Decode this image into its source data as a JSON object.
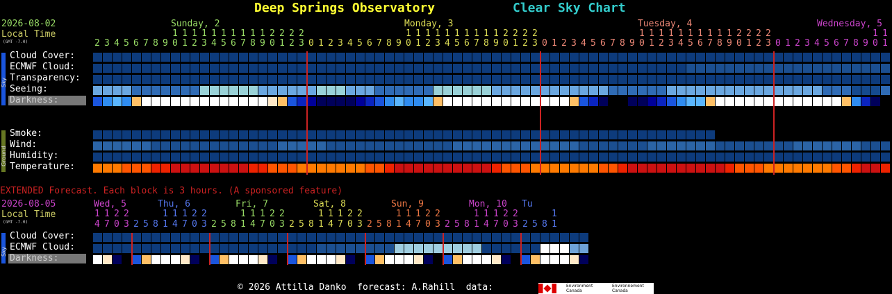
{
  "header": {
    "title": "Deep Springs Observatory",
    "subtitle": "Clear Sky Chart",
    "date": "2026-08-02",
    "local_time_label": "Local Time",
    "gmt_label": "(GMT -7.0)"
  },
  "colors": {
    "title": "#ffff33",
    "subtitle": "#33cccc",
    "date": "#99dd66",
    "local_time": "#cccc66",
    "midnight_line": "#cc2222",
    "extended_note": "#cc2222"
  },
  "days": [
    {
      "label": "Sunday, 2",
      "color": "#99dd66"
    },
    {
      "label": "Monday, 3",
      "color": "#dddd55"
    },
    {
      "label": "Tuesday, 4",
      "color": "#ee8877"
    },
    {
      "label": "Wednesday, 5",
      "color": "#cc44cc"
    }
  ],
  "hours": [
    2,
    3,
    4,
    5,
    6,
    7,
    8,
    9,
    10,
    11,
    12,
    13,
    14,
    15,
    16,
    17,
    18,
    19,
    20,
    21,
    22,
    23,
    0,
    1,
    2,
    3,
    4,
    5,
    6,
    7,
    8,
    9,
    10,
    11,
    12,
    13,
    14,
    15,
    16,
    17,
    18,
    19,
    20,
    21,
    22,
    23,
    0,
    1,
    2,
    3,
    4,
    5,
    6,
    7,
    8,
    9,
    10,
    11,
    12,
    13,
    14,
    15,
    16,
    17,
    18,
    19,
    20,
    21,
    22,
    23,
    0,
    1,
    2,
    3,
    4,
    5,
    6,
    7,
    8,
    9,
    10,
    11
  ],
  "sky_rows": [
    {
      "label": "Cloud Cover:",
      "key": "cloud_cover"
    },
    {
      "label": "ECMWF Cloud:",
      "key": "ecmwf_cloud"
    },
    {
      "label": "Transparency:",
      "key": "transparency"
    },
    {
      "label": "Seeing:",
      "key": "seeing"
    },
    {
      "label": "Darkness:",
      "key": "darkness"
    }
  ],
  "ground_rows": [
    {
      "label": "Smoke:",
      "key": "smoke"
    },
    {
      "label": "Wind:",
      "key": "wind"
    },
    {
      "label": "Humidity:",
      "key": "humidity"
    },
    {
      "label": "Temperature:",
      "key": "temperature"
    }
  ],
  "side_labels": {
    "sky": "Sky",
    "ground": "Ground"
  },
  "extended": {
    "note": "EXTENDED Forecast. Each block is 3 hours. (A sponsored feature)",
    "date": "2026-08-05",
    "local_time_label": "Local Time",
    "gmt_label": "(GMT -7.0)",
    "days": [
      {
        "label": "Wed, 5",
        "color": "#cc44cc"
      },
      {
        "label": "Thu, 6",
        "color": "#5577ee"
      },
      {
        "label": "Fri, 7",
        "color": "#99dd66"
      },
      {
        "label": "Sat, 8",
        "color": "#dddd55"
      },
      {
        "label": "Sun, 9",
        "color": "#ee7744"
      },
      {
        "label": "Mon, 10",
        "color": "#cc44cc"
      },
      {
        "label": "Tu",
        "color": "#5577ee"
      }
    ],
    "hours": [
      14,
      17,
      20,
      23,
      2,
      5,
      8,
      11,
      14,
      17,
      20,
      23,
      2,
      5,
      8,
      11,
      14,
      17,
      20,
      23,
      2,
      5,
      8,
      11,
      14,
      17,
      20,
      23,
      2,
      5,
      8,
      11,
      14,
      17,
      20,
      23,
      2,
      5,
      8,
      11,
      14,
      17,
      20,
      23,
      2,
      5,
      8,
      11,
      14,
      17,
      20
    ],
    "rows": [
      {
        "label": "Cloud Cover:",
        "key": "cloud_cover"
      },
      {
        "label": "ECMWF Cloud:",
        "key": "ecmwf_cloud"
      },
      {
        "label": "Darkness:",
        "key": "darkness"
      }
    ]
  },
  "footer": {
    "text": "© 2026 Attilla Danko  forecast: A.Rahill  data:",
    "logo_text_1": "Environment Canada",
    "logo_text_2": "Environnement Canada"
  },
  "chart_data": {
    "type": "heatmap",
    "title": "Clear Sky Chart",
    "palette": {
      "cloud": [
        "#0d3b7c",
        "#1b4f91",
        "#2b64a6",
        "#4a83c4",
        "#6fa3d8",
        "#9ecde0",
        "#ffffff"
      ],
      "seeing": [
        "#2f6bb5",
        "#6aa7e0",
        "#99d2d8",
        "#154a8e"
      ],
      "darkness": [
        "#000000",
        "#00005a",
        "#000099",
        "#0a24c0",
        "#1a55dd",
        "#2f8cf0",
        "#5ab6ff",
        "#ffc066",
        "#ffe9c8",
        "#ffffff"
      ],
      "temperature": [
        "#cc1111",
        "#ee2200",
        "#ff5500",
        "#ff7a00"
      ]
    },
    "series": [
      {
        "key": "cloud_cover",
        "values": [
          0,
          0,
          0,
          0,
          0,
          0,
          0,
          0,
          0,
          0,
          0,
          0,
          0,
          0,
          0,
          0,
          0,
          0,
          0,
          0,
          0,
          0,
          0,
          0,
          0,
          0,
          0,
          0,
          0,
          0,
          0,
          0,
          0,
          0,
          0,
          0,
          0,
          0,
          0,
          0,
          0,
          0,
          0,
          0,
          0,
          0,
          0,
          0,
          0,
          0,
          0,
          0,
          0,
          0,
          0,
          0,
          0,
          0,
          0,
          0,
          0,
          0,
          0,
          0,
          0,
          0,
          0,
          0,
          0,
          0,
          0,
          0,
          0,
          0,
          0,
          0,
          0,
          0,
          0,
          0,
          0,
          0
        ]
      },
      {
        "key": "ecmwf_cloud",
        "values": [
          0,
          0,
          0,
          0,
          0,
          0,
          0,
          0,
          0,
          0,
          0,
          0,
          0,
          0,
          0,
          0,
          0,
          0,
          0,
          0,
          0,
          0,
          0,
          0,
          0,
          0,
          0,
          0,
          0,
          0,
          0,
          0,
          0,
          0,
          0,
          0,
          0,
          0,
          0,
          0,
          0,
          0,
          0,
          0,
          0,
          0,
          0,
          0,
          0,
          0,
          0,
          0,
          0,
          0,
          0,
          0,
          0,
          0,
          0,
          0,
          0,
          1,
          1,
          1,
          1,
          1,
          1,
          1,
          1,
          1,
          1,
          1,
          1,
          1,
          1,
          1,
          1,
          1,
          1,
          1,
          1,
          1
        ]
      },
      {
        "key": "transparency",
        "values": [
          0,
          0,
          0,
          0,
          0,
          0,
          0,
          0,
          0,
          0,
          0,
          0,
          0,
          0,
          0,
          0,
          0,
          0,
          0,
          0,
          0,
          0,
          0,
          0,
          0,
          0,
          0,
          0,
          0,
          0,
          0,
          0,
          0,
          0,
          0,
          0,
          0,
          0,
          0,
          0,
          0,
          0,
          0,
          0,
          0,
          0,
          0,
          0,
          0,
          0,
          0,
          0,
          0,
          0,
          0,
          0,
          0,
          0,
          0,
          0,
          0,
          0,
          0,
          0,
          0,
          0,
          0,
          0,
          0,
          0,
          0,
          0,
          0,
          0,
          0,
          0,
          0,
          0,
          0,
          0,
          0,
          0
        ]
      },
      {
        "key": "seeing",
        "values": [
          1,
          1,
          1,
          1,
          0,
          0,
          0,
          0,
          0,
          0,
          0,
          2,
          2,
          2,
          2,
          2,
          2,
          1,
          1,
          1,
          1,
          1,
          1,
          2,
          2,
          2,
          1,
          1,
          1,
          0,
          0,
          0,
          0,
          0,
          0,
          2,
          2,
          2,
          2,
          2,
          2,
          1,
          1,
          1,
          1,
          1,
          1,
          1,
          1,
          1,
          1,
          1,
          1,
          0,
          0,
          0,
          0,
          0,
          0,
          1,
          1,
          1,
          1,
          1,
          1,
          1,
          1,
          1,
          1,
          1,
          1,
          1,
          1,
          1,
          1,
          0,
          0,
          0,
          3,
          3,
          3,
          0
        ]
      },
      {
        "key": "darkness",
        "values": [
          4,
          5,
          6,
          5,
          7,
          9,
          9,
          9,
          9,
          9,
          9,
          9,
          9,
          9,
          9,
          9,
          9,
          9,
          8,
          7,
          4,
          3,
          2,
          1,
          1,
          1,
          1,
          2,
          3,
          4,
          5,
          6,
          5,
          5,
          6,
          7,
          9,
          9,
          9,
          9,
          9,
          9,
          9,
          9,
          9,
          9,
          9,
          9,
          9,
          7,
          4,
          3,
          1,
          0,
          0,
          1,
          1,
          2,
          3,
          4,
          5,
          6,
          6,
          7,
          9,
          9,
          9,
          9,
          9,
          9,
          9,
          9,
          9,
          9,
          9,
          9,
          9,
          7,
          5,
          3,
          1,
          0
        ]
      },
      {
        "key": "smoke",
        "values": [
          0,
          0,
          0,
          0,
          0,
          0,
          0,
          0,
          0,
          0,
          0,
          0,
          0,
          0,
          0,
          0,
          0,
          0,
          0,
          0,
          0,
          0,
          0,
          0,
          0,
          0,
          0,
          0,
          0,
          0,
          0,
          0,
          0,
          0,
          0,
          0,
          0,
          0,
          0,
          0,
          0,
          0,
          0,
          0,
          0,
          0,
          0,
          0,
          0,
          0,
          0,
          0,
          0,
          0,
          0,
          0,
          0,
          0,
          0,
          0,
          0,
          0,
          0,
          0,
          null,
          null,
          null,
          null,
          null,
          null,
          null,
          null,
          null,
          null,
          null,
          null,
          null,
          null,
          null,
          null,
          null,
          null
        ]
      },
      {
        "key": "wind",
        "values": [
          2,
          2,
          2,
          2,
          2,
          2,
          1,
          1,
          1,
          1,
          1,
          1,
          1,
          1,
          1,
          1,
          1,
          1,
          1,
          2,
          2,
          2,
          2,
          2,
          1,
          1,
          1,
          1,
          1,
          1,
          1,
          1,
          1,
          1,
          1,
          1,
          1,
          2,
          2,
          2,
          2,
          2,
          2,
          2,
          2,
          2,
          2,
          2,
          2,
          2,
          1,
          1,
          1,
          1,
          1,
          1,
          1,
          2,
          2,
          2,
          2,
          2,
          2,
          2,
          1,
          1,
          1,
          1,
          1,
          1,
          1,
          1,
          2,
          2,
          2,
          2,
          2,
          2,
          2,
          1,
          1,
          1
        ]
      },
      {
        "key": "humidity",
        "values": [
          0,
          0,
          0,
          0,
          0,
          0,
          0,
          0,
          0,
          0,
          0,
          0,
          0,
          0,
          0,
          0,
          0,
          0,
          0,
          0,
          0,
          0,
          0,
          0,
          0,
          0,
          0,
          0,
          0,
          0,
          0,
          0,
          0,
          0,
          0,
          0,
          0,
          0,
          0,
          0,
          0,
          0,
          0,
          0,
          0,
          0,
          0,
          0,
          0,
          0,
          0,
          0,
          0,
          0,
          0,
          0,
          0,
          0,
          0,
          0,
          0,
          0,
          0,
          0,
          0,
          0,
          0,
          0,
          0,
          0,
          0,
          0,
          0,
          0,
          0,
          0,
          0,
          0,
          0,
          0,
          0,
          0
        ]
      },
      {
        "key": "temperature",
        "values": [
          3,
          3,
          3,
          2,
          2,
          2,
          1,
          1,
          0,
          0,
          0,
          0,
          0,
          0,
          0,
          0,
          1,
          1,
          2,
          2,
          2,
          3,
          3,
          3,
          3,
          3,
          3,
          3,
          2,
          2,
          1,
          0,
          0,
          0,
          0,
          0,
          0,
          0,
          0,
          0,
          0,
          1,
          2,
          2,
          2,
          3,
          3,
          3,
          3,
          3,
          3,
          3,
          2,
          2,
          1,
          0,
          0,
          0,
          0,
          0,
          0,
          0,
          0,
          0,
          0,
          1,
          2,
          2,
          2,
          3,
          3,
          3,
          3,
          3,
          3,
          3,
          2,
          2,
          1,
          0,
          0,
          1
        ]
      }
    ],
    "extended_series": [
      {
        "key": "cloud_cover",
        "values": [
          0,
          0,
          0,
          0,
          0,
          0,
          0,
          0,
          0,
          0,
          0,
          0,
          0,
          0,
          0,
          0,
          0,
          0,
          0,
          0,
          0,
          0,
          0,
          0,
          0,
          0,
          0,
          0,
          0,
          0,
          0,
          0,
          0,
          0,
          0,
          0,
          0,
          0,
          0,
          0,
          0,
          0,
          0,
          0,
          0,
          0,
          0,
          0,
          0,
          0,
          0
        ]
      },
      {
        "key": "ecmwf_cloud",
        "values": [
          0,
          0,
          0,
          0,
          0,
          0,
          0,
          0,
          0,
          0,
          0,
          0,
          0,
          0,
          0,
          0,
          0,
          0,
          0,
          0,
          0,
          0,
          0,
          1,
          1,
          1,
          1,
          1,
          1,
          1,
          1,
          2,
          2,
          2,
          2,
          2,
          2,
          2,
          2,
          2,
          0,
          0,
          0,
          0,
          0,
          0,
          3,
          3,
          3,
          4,
          4
        ]
      },
      {
        "key": "darkness",
        "values": [
          9,
          8,
          1,
          0,
          2,
          7,
          9,
          9,
          9,
          8,
          1,
          0,
          2,
          7,
          9,
          9,
          9,
          8,
          1,
          0,
          2,
          7,
          9,
          9,
          9,
          8,
          1,
          0,
          2,
          7,
          9,
          9,
          9,
          8,
          1,
          0,
          2,
          7,
          9,
          9,
          9,
          8,
          1,
          0,
          2,
          7,
          9,
          9,
          9,
          8,
          1
        ]
      }
    ],
    "extended_palette": {
      "cloud": [
        "#0d3b7c",
        "#1b4f91",
        "#9ecde0",
        "#ffffff",
        "#6fa3d8"
      ],
      "darkness": [
        "#000000",
        "#00005a",
        "#1a55dd",
        "#000099",
        "#0a24c0",
        "#2f8cf0",
        "#5ab6ff",
        "#ffc066",
        "#ffe9c8",
        "#ffffff"
      ]
    },
    "midnight_after_hour_index": [
      21,
      45,
      69
    ]
  }
}
